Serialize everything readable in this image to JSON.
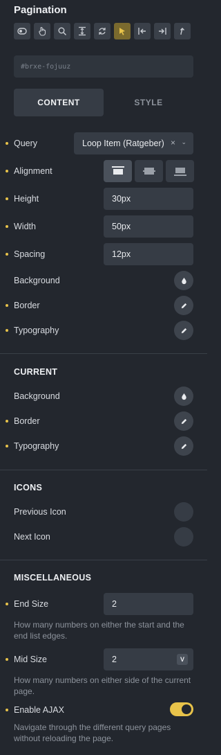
{
  "header": {
    "title": "Pagination"
  },
  "states": [
    {
      "icon": "toggle-icon"
    },
    {
      "icon": "hover-hand-icon"
    },
    {
      "icon": "search-icon"
    },
    {
      "icon": "expand-vertical-icon"
    },
    {
      "icon": "refresh-icon"
    },
    {
      "icon": "cursor-icon",
      "active": true
    },
    {
      "icon": "arrow-left-bar-icon"
    },
    {
      "icon": "arrow-right-bar-icon"
    },
    {
      "icon": "arrow-up-curve-icon"
    }
  ],
  "element_id": "#brxe-fojuuz",
  "tabs": {
    "content": "CONTENT",
    "style": "STYLE"
  },
  "content": {
    "query": {
      "label": "Query",
      "value": "Loop Item (Ratgeber)"
    },
    "alignment": {
      "label": "Alignment"
    },
    "height": {
      "label": "Height",
      "value": "30px"
    },
    "width": {
      "label": "Width",
      "value": "50px"
    },
    "spacing": {
      "label": "Spacing",
      "value": "12px"
    },
    "background": {
      "label": "Background"
    },
    "border": {
      "label": "Border"
    },
    "typography": {
      "label": "Typography"
    }
  },
  "current": {
    "title": "CURRENT",
    "background": {
      "label": "Background"
    },
    "border": {
      "label": "Border"
    },
    "typography": {
      "label": "Typography"
    }
  },
  "icons": {
    "title": "ICONS",
    "previous": {
      "label": "Previous Icon"
    },
    "next": {
      "label": "Next Icon"
    }
  },
  "misc": {
    "title": "MISCELLANEOUS",
    "end_size": {
      "label": "End Size",
      "value": "2",
      "desc": "How many numbers on either the start and the end list edges."
    },
    "mid_size": {
      "label": "Mid Size",
      "value": "2",
      "badge": "V",
      "desc": "How many numbers on either side of the current page."
    },
    "ajax": {
      "label": "Enable AJAX",
      "enabled": true,
      "desc": "Navigate through the different query pages without reloading the page."
    }
  },
  "colors": {
    "accent": "#e8c34a",
    "background": "#23272e",
    "field": "#363c45"
  }
}
